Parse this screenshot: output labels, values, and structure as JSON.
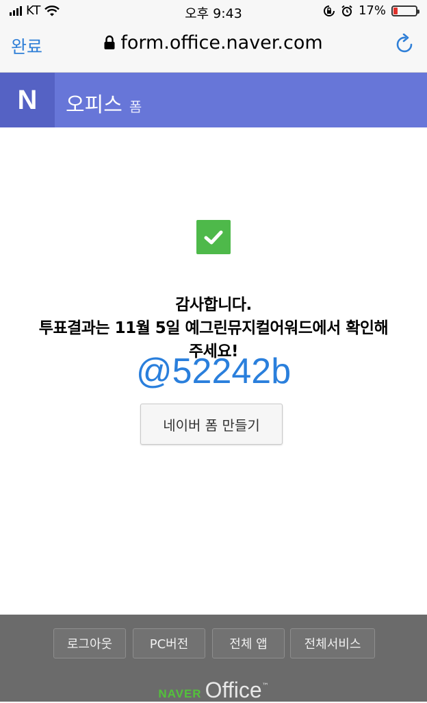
{
  "status_bar": {
    "carrier": "KT",
    "time": "오후 9:43",
    "battery_percent": "17%",
    "battery_level": 0.17
  },
  "browser": {
    "done_label": "완료",
    "url": "form.office.naver.com"
  },
  "header": {
    "logo": "N",
    "title": "오피스",
    "subtitle": "폼"
  },
  "main": {
    "message_line1": "감사합니다.",
    "message_line2": "투표결과는 11월 5일 예그린뮤지컬어워드에서 확인해",
    "message_line3": "주세요!",
    "handle": "@52242b",
    "create_button": "네이버 폼 만들기"
  },
  "footer": {
    "buttons": [
      "로그아웃",
      "PC버전",
      "전체 앱",
      "전체서비스"
    ],
    "logo_naver": "NAVER",
    "logo_office": "Office",
    "logo_tm": "™"
  },
  "colors": {
    "header_bg": "#6776d8",
    "check_green": "#4eb94a",
    "link_blue": "#2f7fd7",
    "footer_bg": "#6b6b6b"
  }
}
